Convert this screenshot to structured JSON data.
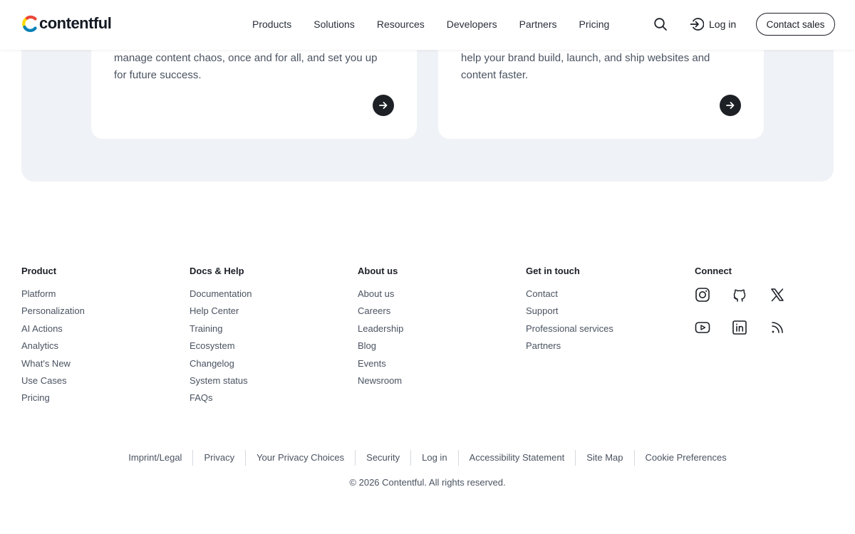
{
  "header": {
    "logo_text": "contentful",
    "nav": [
      "Products",
      "Solutions",
      "Resources",
      "Developers",
      "Partners",
      "Pricing"
    ],
    "login_label": "Log in",
    "contact_label": "Contact sales"
  },
  "cards": [
    {
      "text": "manage content chaos, once and for all, and set you up for future success."
    },
    {
      "text": "help your brand build, launch, and ship websites and content faster."
    }
  ],
  "footer": {
    "product": {
      "title": "Product",
      "links": [
        "Platform",
        "Personalization",
        "AI Actions",
        "Analytics",
        "What's New",
        "Use Cases",
        "Pricing"
      ]
    },
    "docs": {
      "title": "Docs & Help",
      "links": [
        "Documentation",
        "Help Center",
        "Training",
        "Ecosystem",
        "Changelog",
        "System status",
        "FAQs"
      ]
    },
    "about": {
      "title": "About us",
      "links": [
        "About us",
        "Careers",
        "Leadership",
        "Blog",
        "Events",
        "Newsroom"
      ]
    },
    "touch": {
      "title": "Get in touch",
      "links": [
        "Contact",
        "Support",
        "Professional services",
        "Partners"
      ]
    },
    "connect": {
      "title": "Connect",
      "icons": [
        "instagram-icon",
        "github-icon",
        "x-icon",
        "youtube-icon",
        "linkedin-icon",
        "rss-icon"
      ]
    }
  },
  "legal": [
    "Imprint/Legal",
    "Privacy",
    "Your Privacy Choices",
    "Security",
    "Log in",
    "Accessibility Statement",
    "Site Map",
    "Cookie Preferences"
  ],
  "copyright": "© 2026 Contentful. All rights reserved.",
  "colors": {
    "text": "#1b1f26",
    "muted": "#4a5361",
    "panel": "#eff2f6",
    "logo_yellow": "#ffda00",
    "logo_blue": "#0681b6",
    "logo_red": "#e9483a"
  }
}
